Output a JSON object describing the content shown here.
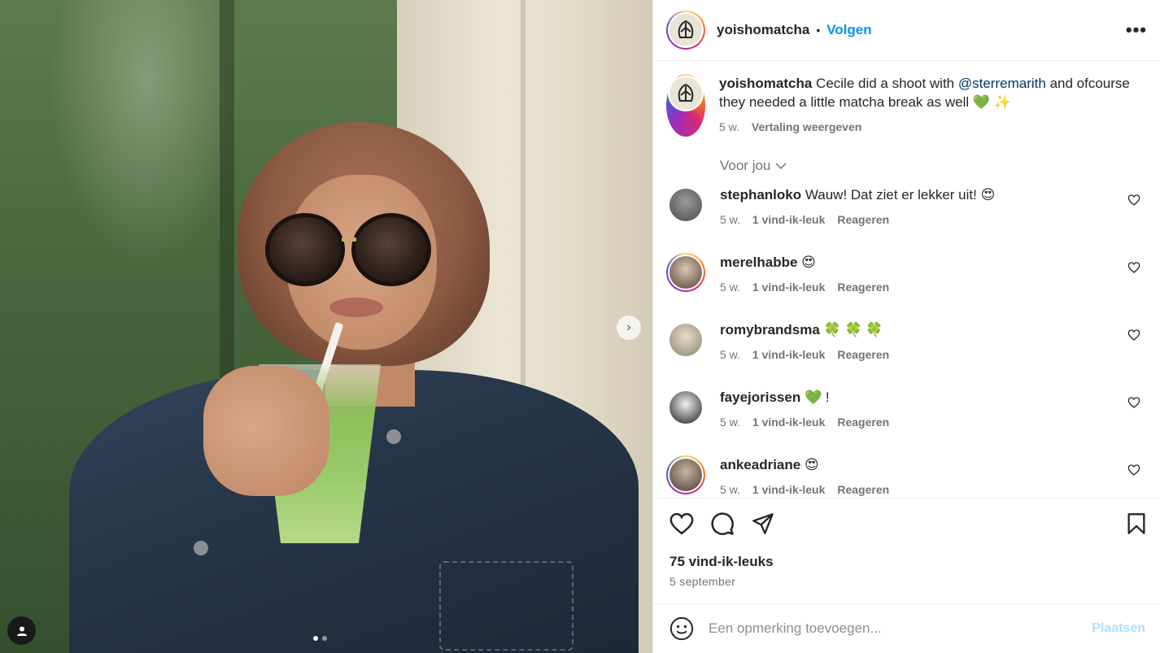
{
  "post": {
    "author": "yoishomatcha",
    "separator": "•",
    "follow_label": "Volgen",
    "more_label": "•••",
    "carousel_next": "›"
  },
  "caption": {
    "author": "yoishomatcha",
    "text_before": "Cecile did a shoot with",
    "mention": "@sterremarith",
    "text_after": "and ofcourse they needed a little matcha break as well 💚 ✨",
    "time": "5 w.",
    "translate_label": "Vertaling weergeven"
  },
  "filter": {
    "label": "Voor jou",
    "chevron": "⌵"
  },
  "comments": [
    {
      "user": "stephanloko",
      "text": "Wauw! Dat ziet er lekker uit! 😍",
      "time": "5 w.",
      "likes": "1 vind-ik-leuk",
      "reply": "Reageren"
    },
    {
      "user": "merelhabbe",
      "text": "😍",
      "time": "5 w.",
      "likes": "1 vind-ik-leuk",
      "reply": "Reageren"
    },
    {
      "user": "romybrandsma",
      "text": "🍀 🍀 🍀",
      "time": "5 w.",
      "likes": "1 vind-ik-leuk",
      "reply": "Reageren"
    },
    {
      "user": "fayejorissen",
      "text": "💚 !",
      "time": "5 w.",
      "likes": "1 vind-ik-leuk",
      "reply": "Reageren"
    },
    {
      "user": "ankeadriane",
      "text": "😍",
      "time": "5 w.",
      "likes": "1 vind-ik-leuk",
      "reply": "Reageren"
    }
  ],
  "stats": {
    "likes": "75 vind-ik-leuks",
    "date": "5 september"
  },
  "composer": {
    "placeholder": "Een opmerking toevoegen...",
    "post_label": "Plaatsen"
  },
  "colors": {
    "link_blue": "#0095f6",
    "mention_blue": "#00376b",
    "muted": "#737373",
    "post_disabled": "#b2dffc"
  },
  "icons": [
    "heart-icon",
    "comment-icon",
    "share-icon",
    "bookmark-icon",
    "emoji-icon",
    "user-tag-icon",
    "chevron-right-icon"
  ]
}
